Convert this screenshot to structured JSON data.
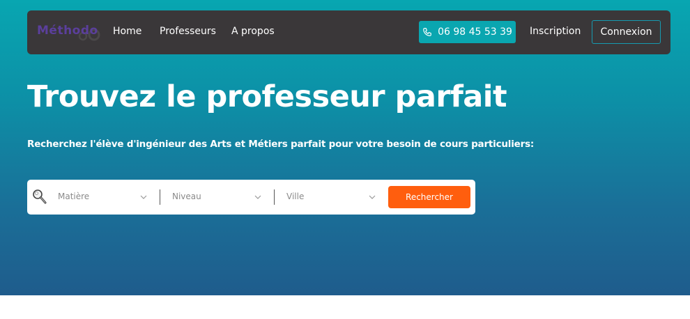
{
  "brand": {
    "logo_text": "Méthodo",
    "accent": "#5b3f9c"
  },
  "nav": {
    "links": [
      {
        "label": "Home"
      },
      {
        "label": "Professeurs"
      },
      {
        "label": "A propos"
      }
    ],
    "phone": "06 98 45 53 39",
    "phone_icon": "phone-icon",
    "signup": "Inscription",
    "login": "Connexion"
  },
  "hero": {
    "title": "Trouvez le professeur parfait",
    "subtitle": "Recherchez l'élève d'ingénieur des Arts et Métiers parfait pour votre besoin de cours particuliers:"
  },
  "search": {
    "icon": "magnifier-icon",
    "subject_placeholder": "Matière",
    "level_placeholder": "Niveau",
    "city_placeholder": "Ville",
    "button": "Rechercher",
    "button_color": "#ff5e0e"
  },
  "colors": {
    "navbar_bg": "#3a3739",
    "teal": "#0aa6b0",
    "gradient_top": "#08a6b1",
    "gradient_bottom": "#1f5c8c"
  }
}
